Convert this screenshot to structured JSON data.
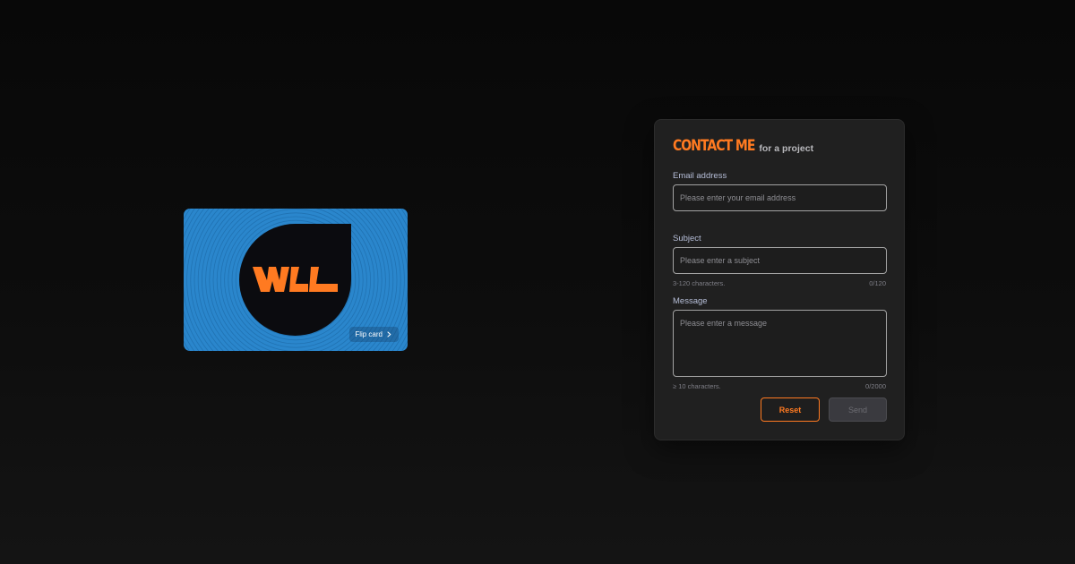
{
  "card": {
    "logo_text": "WLL",
    "flip_label": "Flip card",
    "colors": {
      "background": "#2a86cc",
      "blob": "#0b0b0f",
      "logo": "#ff7a21"
    }
  },
  "contact": {
    "title_accent": "CONTACT ME",
    "title_rest": "for a project",
    "email": {
      "label": "Email address",
      "placeholder": "Please enter your email address",
      "value": ""
    },
    "subject": {
      "label": "Subject",
      "placeholder": "Please enter a subject",
      "value": "",
      "hint": "3-120 characters.",
      "counter": "0/120"
    },
    "message": {
      "label": "Message",
      "placeholder": "Please enter a message",
      "value": "",
      "hint": "≥ 10 characters.",
      "counter": "0/2000"
    },
    "reset_label": "Reset",
    "send_label": "Send",
    "colors": {
      "accent": "#ff7a21",
      "panel": "#202020"
    }
  }
}
